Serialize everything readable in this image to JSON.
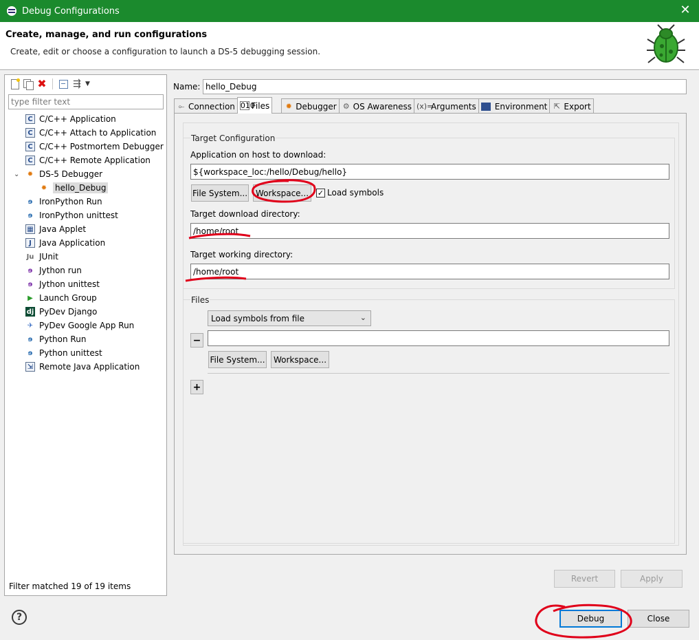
{
  "window": {
    "title": "Debug Configurations"
  },
  "header": {
    "title": "Create, manage, and run configurations",
    "description": "Create, edit or choose a configuration to launch a DS-5 debugging session."
  },
  "left": {
    "filter_placeholder": "type filter text",
    "tree": [
      {
        "label": "C/C++ Application",
        "icon": "c-app-icon",
        "level": 1
      },
      {
        "label": "C/C++ Attach to Application",
        "icon": "c-app-icon",
        "level": 1
      },
      {
        "label": "C/C++ Postmortem Debugger",
        "icon": "c-app-icon",
        "level": 1
      },
      {
        "label": "C/C++ Remote Application",
        "icon": "c-app-icon",
        "level": 1
      },
      {
        "label": "DS-5 Debugger",
        "icon": "ds5-debugger-icon",
        "level": 1,
        "expanded": true
      },
      {
        "label": "hello_Debug",
        "icon": "ds5-debugger-icon",
        "level": 2,
        "selected": true
      },
      {
        "label": "IronPython Run",
        "icon": "ironpython-icon",
        "level": 1
      },
      {
        "label": "IronPython unittest",
        "icon": "ironpython-unittest-icon",
        "level": 1
      },
      {
        "label": "Java Applet",
        "icon": "java-applet-icon",
        "level": 1
      },
      {
        "label": "Java Application",
        "icon": "java-app-icon",
        "level": 1
      },
      {
        "label": "JUnit",
        "icon": "junit-icon",
        "level": 1
      },
      {
        "label": "Jython run",
        "icon": "jython-icon",
        "level": 1
      },
      {
        "label": "Jython unittest",
        "icon": "jython-unittest-icon",
        "level": 1
      },
      {
        "label": "Launch Group",
        "icon": "launch-group-icon",
        "level": 1
      },
      {
        "label": "PyDev Django",
        "icon": "django-icon",
        "level": 1
      },
      {
        "label": "PyDev Google App Run",
        "icon": "google-app-icon",
        "level": 1
      },
      {
        "label": "Python Run",
        "icon": "python-icon",
        "level": 1
      },
      {
        "label": "Python unittest",
        "icon": "python-unittest-icon",
        "level": 1
      },
      {
        "label": "Remote Java Application",
        "icon": "remote-java-icon",
        "level": 1
      }
    ],
    "status": "Filter matched 19 of 19 items"
  },
  "right": {
    "name_label": "Name:",
    "name_value": "hello_Debug",
    "tabs": [
      {
        "label": "Connection",
        "icon": "connection-icon"
      },
      {
        "label": "Files",
        "icon": "files-icon",
        "active": true
      },
      {
        "label": "Debugger",
        "icon": "debugger-icon"
      },
      {
        "label": "OS Awareness",
        "icon": "os-awareness-icon"
      },
      {
        "label": "Arguments",
        "icon": "arguments-icon"
      },
      {
        "label": "Environment",
        "icon": "environment-icon"
      },
      {
        "label": "Export",
        "icon": "export-icon"
      }
    ],
    "target_config": {
      "title": "Target Configuration",
      "app_label": "Application on host to download:",
      "app_value": "${workspace_loc:/hello/Debug/hello}",
      "file_system_btn": "File System...",
      "workspace_btn": "Workspace...",
      "load_symbols_label": "Load symbols",
      "load_symbols_checked": true,
      "download_dir_label": "Target download directory:",
      "download_dir_value": "/home/root",
      "working_dir_label": "Target working directory:",
      "working_dir_value": "/home/root"
    },
    "files": {
      "title": "Files",
      "select_value": "Load symbols from file",
      "file_value": "",
      "file_system_btn": "File System...",
      "workspace_btn": "Workspace...",
      "remove_btn": "−",
      "add_btn": "+"
    },
    "revert_btn": "Revert",
    "apply_btn": "Apply"
  },
  "footer": {
    "help": "?",
    "debug_btn": "Debug",
    "close_btn": "Close"
  },
  "colors": {
    "titlebar": "#1b8a2d",
    "annotation": "#e0001a",
    "default_button_border": "#0078d7"
  }
}
